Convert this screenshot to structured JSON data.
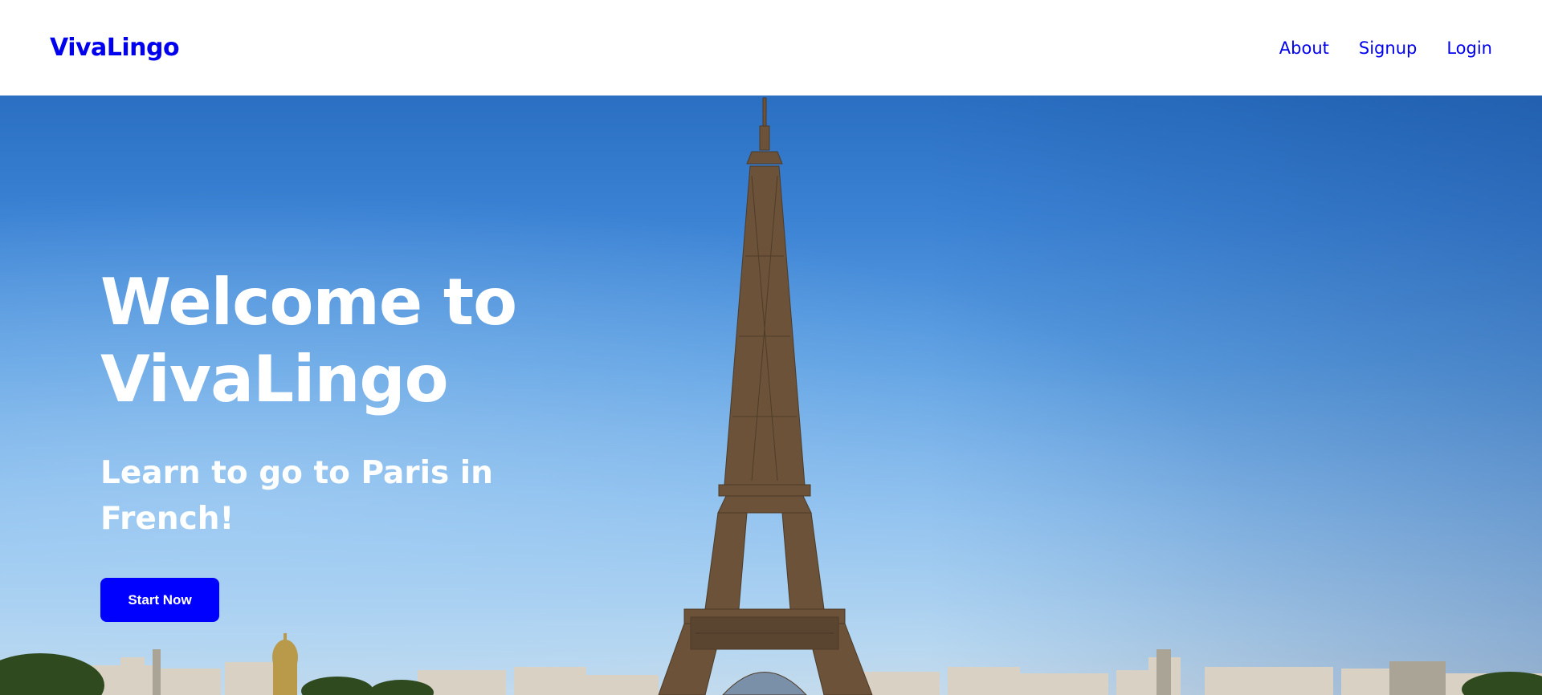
{
  "nav": {
    "brand": "VivaLingo",
    "links": [
      {
        "label": "About"
      },
      {
        "label": "Signup"
      },
      {
        "label": "Login"
      }
    ]
  },
  "hero": {
    "title_line1": "Welcome to",
    "title_line2": "VivaLingo",
    "subtitle_line1": "Learn to go to Paris in",
    "subtitle_line2": "French!",
    "cta_label": "Start Now",
    "background_image": "eiffel-tower-paris-skyline"
  },
  "colors": {
    "brand": "#0000ee",
    "cta": "#0000ff",
    "sky_top": "#2a6fc2",
    "sky_bottom": "#c8dceb",
    "tower": "#6b5238"
  }
}
